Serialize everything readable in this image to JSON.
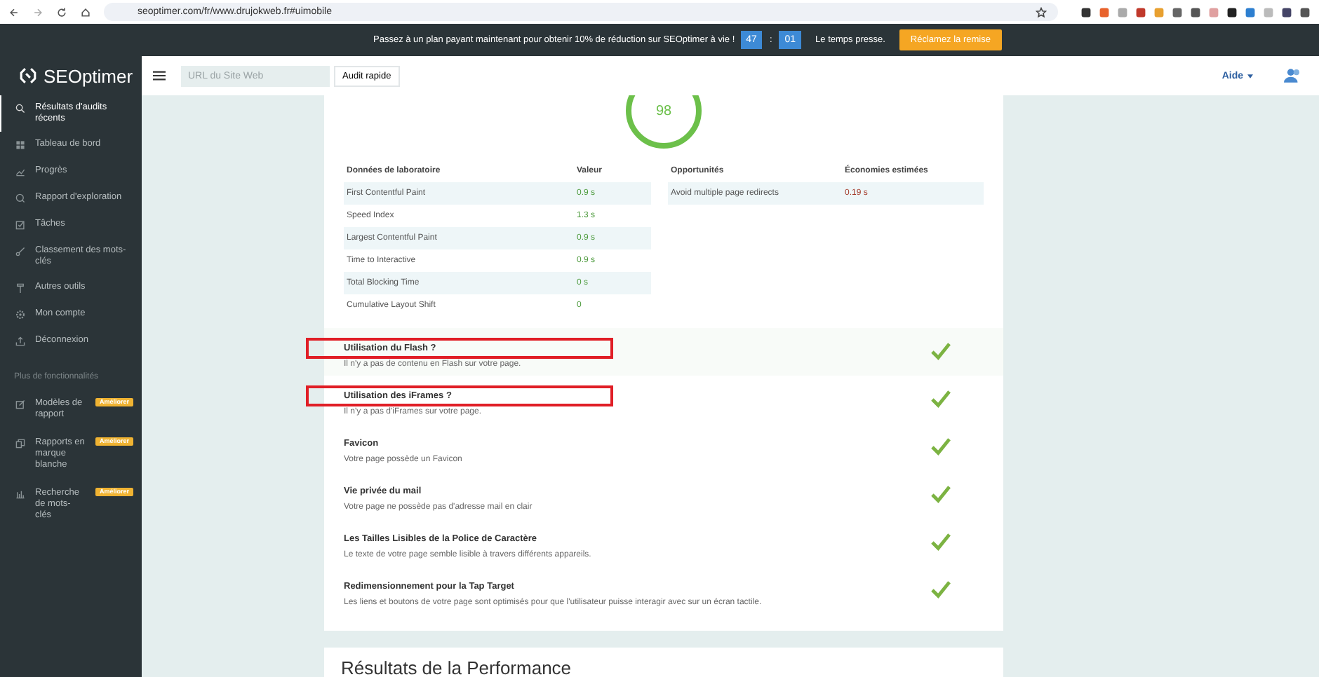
{
  "browser": {
    "url": "seoptimer.com/fr/www.drujokweb.fr#uimobile"
  },
  "promo": {
    "text": "Passez à un plan payant maintenant pour obtenir 10% de réduction sur SEOptimer à vie !",
    "minutes": "47",
    "separator": ":",
    "seconds": "01",
    "urgency": "Le temps presse.",
    "button": "Réclamez la remise"
  },
  "logo": {
    "name": "SEOptimer"
  },
  "header": {
    "search": {
      "placeholder": "URL du Site Web"
    },
    "audit_button": "Audit rapide",
    "help": "Aide"
  },
  "sidebar": {
    "items": [
      {
        "label": "Résultats d'audits récents",
        "selected": true
      },
      {
        "label": "Tableau de bord",
        "selected": false
      },
      {
        "label": "Progrès",
        "selected": false
      },
      {
        "label": "Rapport d'exploration",
        "selected": false
      },
      {
        "label": "Tâches",
        "selected": false
      },
      {
        "label": "Classement des mots-clés",
        "selected": false
      },
      {
        "label": "Autres outils",
        "selected": false
      },
      {
        "label": "Mon compte",
        "selected": false
      },
      {
        "label": "Déconnexion",
        "selected": false
      }
    ],
    "section": "Plus de fonctionnalités",
    "extra_items": [
      {
        "label": "Modèles de rapport",
        "badge": "Améliorer",
        "selected": false
      },
      {
        "label": "Rapports en marque blanche",
        "badge": "Améliorer",
        "selected": false
      },
      {
        "label": "Recherche de mots-clés",
        "badge": "Améliorer",
        "selected": false
      }
    ]
  },
  "score": "98",
  "lab_table": {
    "columns": [
      "Données de laboratoire",
      "Valeur"
    ],
    "rows": [
      {
        "metric": "First Contentful Paint",
        "value": "0.9 s"
      },
      {
        "metric": "Speed Index",
        "value": "1.3 s"
      },
      {
        "metric": "Largest Contentful Paint",
        "value": "0.9 s"
      },
      {
        "metric": "Time to Interactive",
        "value": "0.9 s"
      },
      {
        "metric": "Total Blocking Time",
        "value": "0 s"
      },
      {
        "metric": "Cumulative Layout Shift",
        "value": "0"
      }
    ]
  },
  "opportunities": {
    "columns": [
      "Opportunités",
      "Économies estimées"
    ],
    "rows": [
      {
        "name": "Avoid multiple page redirects",
        "saving": "0.19 s"
      }
    ]
  },
  "checks": [
    {
      "title": "Utilisation du Flash ?",
      "description": "Il n'y a pas de contenu en Flash sur votre page.",
      "passed": true,
      "highlighted": true
    },
    {
      "title": "Utilisation des iFrames ?",
      "description": "Il n'y a pas d'iFrames sur votre page.",
      "passed": true,
      "highlighted": true
    },
    {
      "title": "Favicon",
      "description": "Votre page possède un Favicon",
      "passed": true,
      "highlighted": false
    },
    {
      "title": "Vie privée du mail",
      "description": "Votre page ne possède pas d'adresse mail en clair",
      "passed": true,
      "highlighted": false
    },
    {
      "title": "Les Tailles Lisibles de la Police de Caractère",
      "description": "Le texte de votre page semble lisible à travers différents appareils.",
      "passed": true,
      "highlighted": false
    },
    {
      "title": "Redimensionnement pour la Tap Target",
      "description": "Les liens et boutons de votre page sont optimisés pour que l'utilisateur puisse interagir avec sur un écran tactile.",
      "passed": true,
      "highlighted": false
    }
  ],
  "next_section": {
    "title": "Résultats de la Performance"
  }
}
